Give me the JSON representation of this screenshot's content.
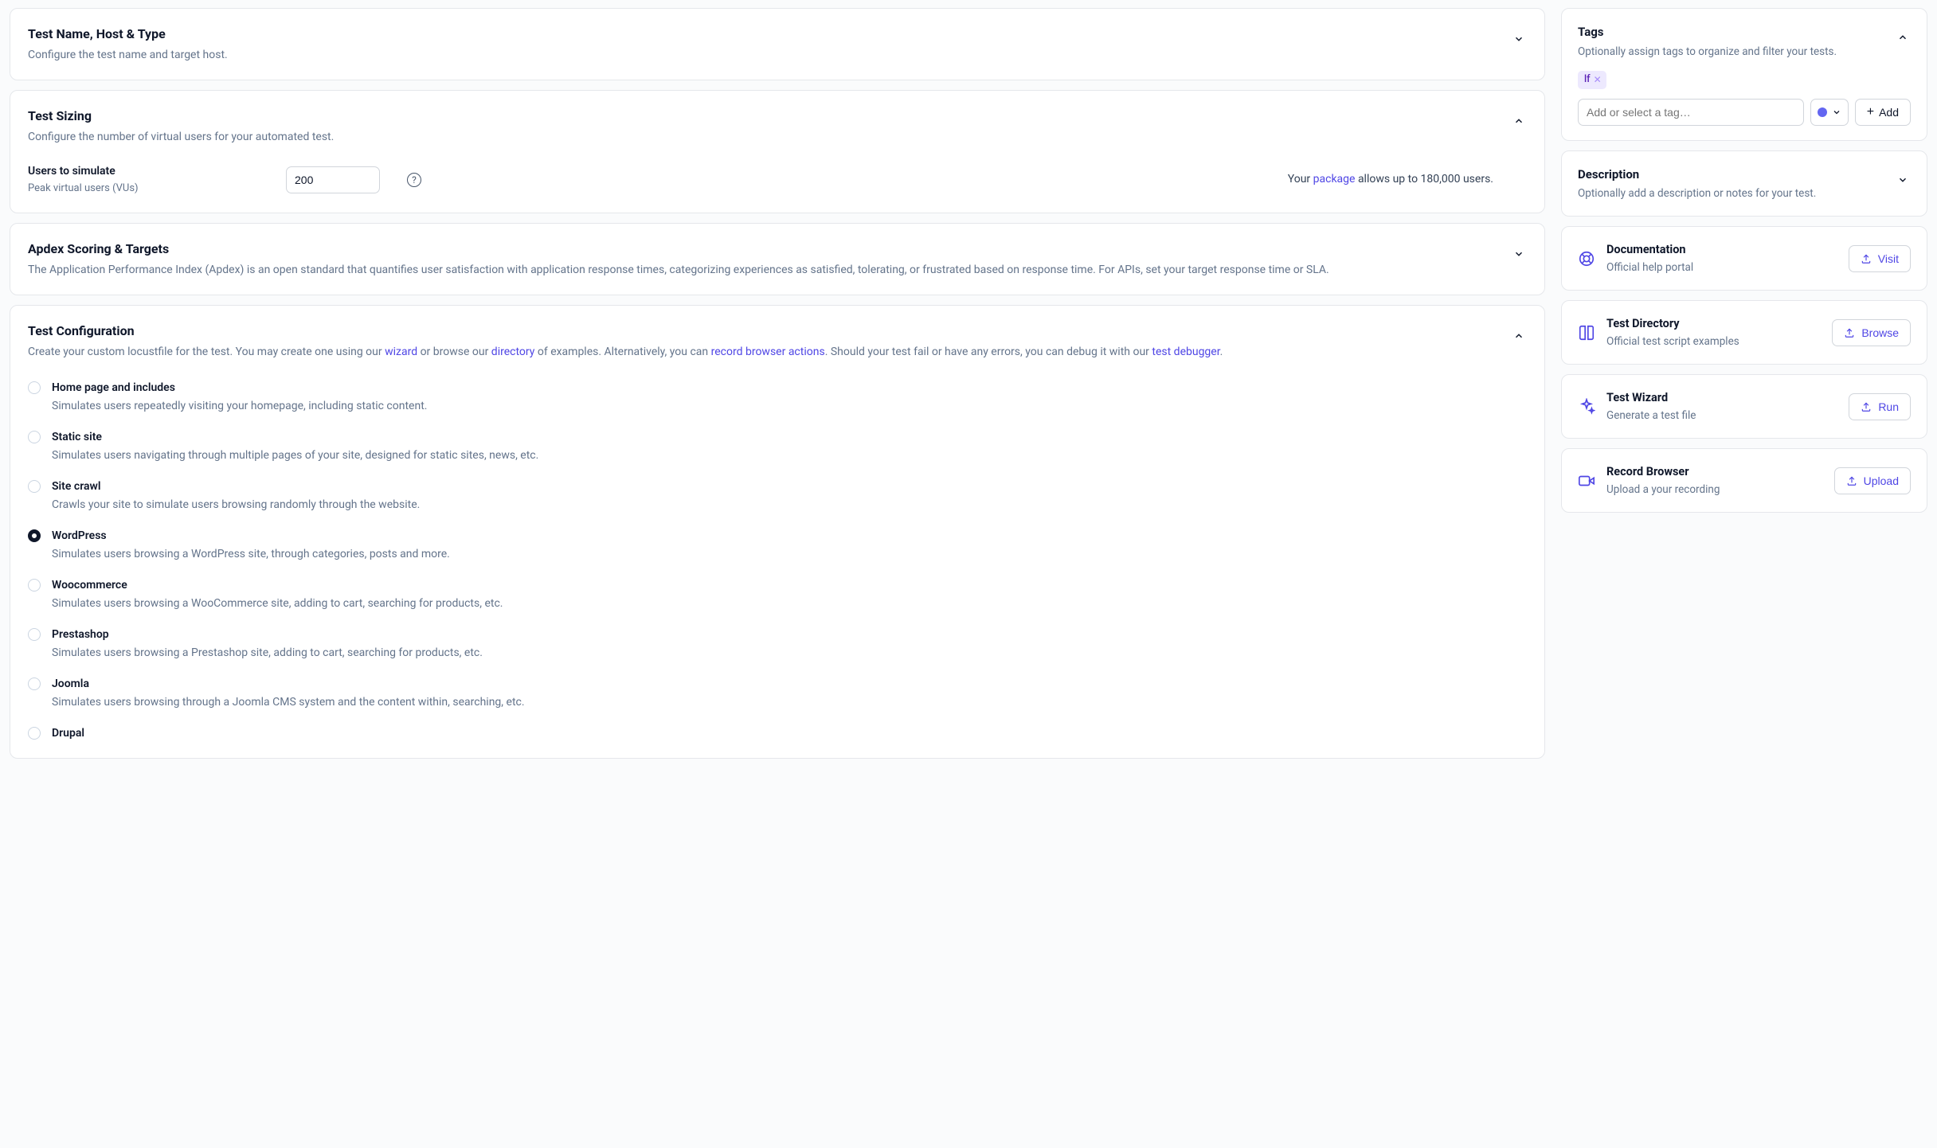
{
  "sections": {
    "name": {
      "title": "Test Name, Host & Type",
      "subtitle": "Configure the test name and target host."
    },
    "sizing": {
      "title": "Test Sizing",
      "subtitle": "Configure the number of virtual users for your automated test.",
      "users_label": "Users to simulate",
      "users_hint": "Peak virtual users (VUs)",
      "users_value": "200",
      "pkg_prefix": "Your ",
      "pkg_link": "package",
      "pkg_suffix": " allows up to 180,000 users."
    },
    "apdex": {
      "title": "Apdex Scoring & Targets",
      "subtitle": "The Application Performance Index (Apdex) is an open standard that quantifies user satisfaction with application response times, categorizing experiences as satisfied, tolerating, or frustrated based on response time. For APIs, set your target response time or SLA."
    },
    "config": {
      "title": "Test Configuration",
      "intro_a": "Create your custom locustfile for the test. You may create one using our ",
      "wizard_link": "wizard",
      "intro_b": " or browse our ",
      "directory_link": "directory",
      "intro_c": " of examples. Alternatively, you can ",
      "record_link": "record browser actions",
      "intro_d": ". Should your test fail or have any errors, you can debug it with our ",
      "debugger_link": "test debugger",
      "intro_e": ".",
      "options": [
        {
          "title": "Home page and includes",
          "desc": "Simulates users repeatedly visiting your homepage, including static content.",
          "selected": false
        },
        {
          "title": "Static site",
          "desc": "Simulates users navigating through multiple pages of your site, designed for static sites, news, etc.",
          "selected": false
        },
        {
          "title": "Site crawl",
          "desc": "Crawls your site to simulate users browsing randomly through the website.",
          "selected": false
        },
        {
          "title": "WordPress",
          "desc": "Simulates users browsing a WordPress site, through categories, posts and more.",
          "selected": true
        },
        {
          "title": "Woocommerce",
          "desc": "Simulates users browsing a WooCommerce site, adding to cart, searching for products, etc.",
          "selected": false
        },
        {
          "title": "Prestashop",
          "desc": "Simulates users browsing a Prestashop site, adding to cart, searching for products, etc.",
          "selected": false
        },
        {
          "title": "Joomla",
          "desc": "Simulates users browsing through a Joomla CMS system and the content within, searching, etc.",
          "selected": false
        },
        {
          "title": "Drupal",
          "desc": "",
          "selected": false
        }
      ]
    }
  },
  "sidebar": {
    "tags": {
      "title": "Tags",
      "subtitle": "Optionally assign tags to organize and filter your tests.",
      "existing": [
        {
          "label": "lf"
        }
      ],
      "placeholder": "Add or select a tag…",
      "color": "#6366f1",
      "add_label": "Add"
    },
    "description": {
      "title": "Description",
      "subtitle": "Optionally add a description or notes for your test."
    },
    "actions": [
      {
        "icon": "life-ring",
        "title": "Documentation",
        "sub": "Official help portal",
        "btn": "Visit"
      },
      {
        "icon": "book",
        "title": "Test Directory",
        "sub": "Official test script examples",
        "btn": "Browse"
      },
      {
        "icon": "sparkle",
        "title": "Test Wizard",
        "sub": "Generate a test file",
        "btn": "Run"
      },
      {
        "icon": "video",
        "title": "Record Browser",
        "sub": "Upload a your recording",
        "btn": "Upload"
      }
    ]
  }
}
